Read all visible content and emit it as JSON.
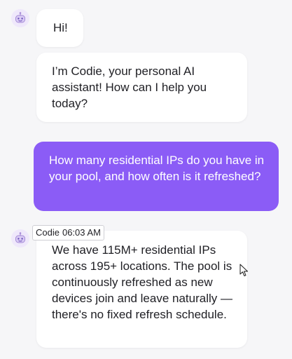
{
  "assistant": {
    "name": "Codie",
    "avatar_icon": "robot-face-icon"
  },
  "messages": [
    {
      "sender": "assistant",
      "text": "Hi!"
    },
    {
      "sender": "assistant",
      "text": "I’m Codie, your personal AI assistant! How can I help you today?"
    },
    {
      "sender": "user",
      "text": "How many residential IPs do you have in your pool, and how often is it refreshed?"
    },
    {
      "sender": "assistant",
      "text": "We have 115M+ residential IPs across 195+ locations. The pool is continuously refreshed as new devices join and leave naturally — there's no fixed refresh schedule."
    }
  ],
  "tooltip": {
    "name": "Codie",
    "time": "06:03 AM"
  },
  "colors": {
    "user_bubble": "#8b5cf6",
    "background": "#f6f6f8",
    "assistant_bubble": "#ffffff"
  }
}
